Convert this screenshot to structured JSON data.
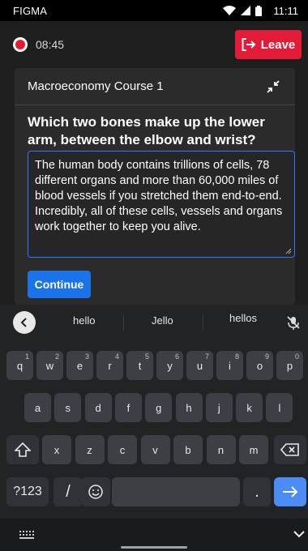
{
  "status_bar": {
    "carrier": "FIGMA",
    "time": "11:11"
  },
  "session": {
    "timer": "08:45",
    "leave_label": "Leave"
  },
  "card": {
    "course_title": "Macroeconomy Course 1",
    "question": "Which two bones make up the lower arm, between the elbow and wrist?",
    "answer_text": "The human body contains trillions of cells, 78 different organs and more than 60,000 miles of blood vessels if you stretched them end-to-end. Incredibly, all of these cells, vessels and organs work together to keep you alive.",
    "continue_label": "Continue"
  },
  "keyboard": {
    "suggestions": [
      "hello",
      "Jello",
      "hellos"
    ],
    "row1": [
      {
        "k": "q",
        "n": "1"
      },
      {
        "k": "w",
        "n": "2"
      },
      {
        "k": "e",
        "n": "3"
      },
      {
        "k": "r",
        "n": "4"
      },
      {
        "k": "t",
        "n": "5"
      },
      {
        "k": "y",
        "n": "6"
      },
      {
        "k": "u",
        "n": "7"
      },
      {
        "k": "i",
        "n": "8"
      },
      {
        "k": "o",
        "n": "9"
      },
      {
        "k": "p",
        "n": "0"
      }
    ],
    "row2": [
      "a",
      "s",
      "d",
      "f",
      "g",
      "h",
      "j",
      "k",
      "l"
    ],
    "row3": [
      "x",
      "z",
      "c",
      "v",
      "b",
      "n",
      "m"
    ],
    "symbols_label": "?123",
    "slash_label": "/",
    "period_label": "."
  },
  "colors": {
    "leave": "#e31b36",
    "primary": "#1a73e8",
    "input_border": "#2f7bff",
    "record": "#e01e2f"
  },
  "icons": [
    "record-icon",
    "exit-icon",
    "collapse-icon",
    "back-chevron-icon",
    "mic-off-icon",
    "shift-icon",
    "backspace-icon",
    "emoji-icon",
    "enter-arrow-icon",
    "keyboard-grid-icon",
    "chevron-down-icon"
  ]
}
